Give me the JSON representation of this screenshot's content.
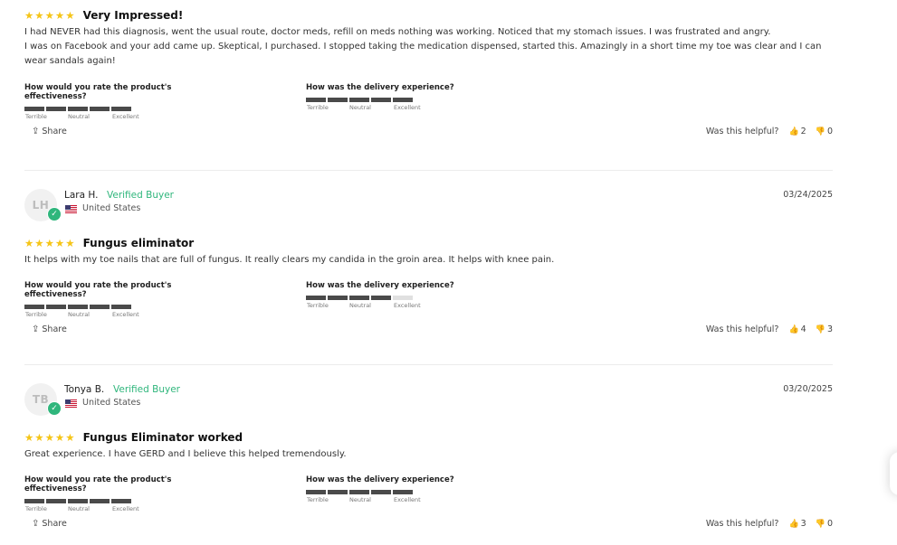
{
  "questions": {
    "effectiveness": "How would you rate the product's effectiveness?",
    "delivery": "How was the delivery experience?"
  },
  "scale_labels": {
    "low": "Terrible",
    "mid": "Neutral",
    "high": "Excellent"
  },
  "share_label": "Share",
  "helpful_label": "Was this helpful?",
  "colors": {
    "star": "#f5c518",
    "verified": "#2fb67c",
    "bar_filled": "#4a4a4a",
    "bar_empty": "#e0e0e0"
  },
  "icons": {
    "share": "share-icon",
    "thumbs_up": "thumbs-up-icon",
    "thumbs_down": "thumbs-down-icon",
    "star": "star-icon",
    "flag": "us-flag-icon",
    "verified": "verified-check-icon"
  },
  "reviews": [
    {
      "rating": 5,
      "stars": "★★★★★",
      "title": "Very Impressed!",
      "body": [
        "I had NEVER had this diagnosis, went the usual route, doctor meds, refill on meds nothing was working. Noticed that my stomach issues. I was frustrated and angry.",
        "I was on Facebook and your add came up. Skeptical, I purchased. I stopped taking the medication dispensed, started this. Amazingly in a short time my toe was clear and I can wear sandals again!"
      ],
      "effectiveness_rating": 5,
      "delivery_rating": 5,
      "helpful_up": "2",
      "helpful_down": "0"
    },
    {
      "initials": "LH",
      "name": "Lara H.",
      "verified": "Verified Buyer",
      "country": "United States",
      "date": "03/24/2025",
      "rating": 5,
      "stars": "★★★★★",
      "title": "Fungus eliminator",
      "body": "It helps with my toe nails that are full of fungus. It really clears my candida in the groin area. It helps with knee pain.",
      "effectiveness_rating": 5,
      "delivery_rating": 4,
      "helpful_up": "4",
      "helpful_down": "3"
    },
    {
      "initials": "TB",
      "name": "Tonya B.",
      "verified": "Verified Buyer",
      "country": "United States",
      "date": "03/20/2025",
      "rating": 5,
      "stars": "★★★★★",
      "title": "Fungus Eliminator worked",
      "body": "Great experience. I have GERD and I believe this helped tremendously.",
      "effectiveness_rating": 5,
      "delivery_rating": 5,
      "helpful_up": "3",
      "helpful_down": "0"
    }
  ]
}
